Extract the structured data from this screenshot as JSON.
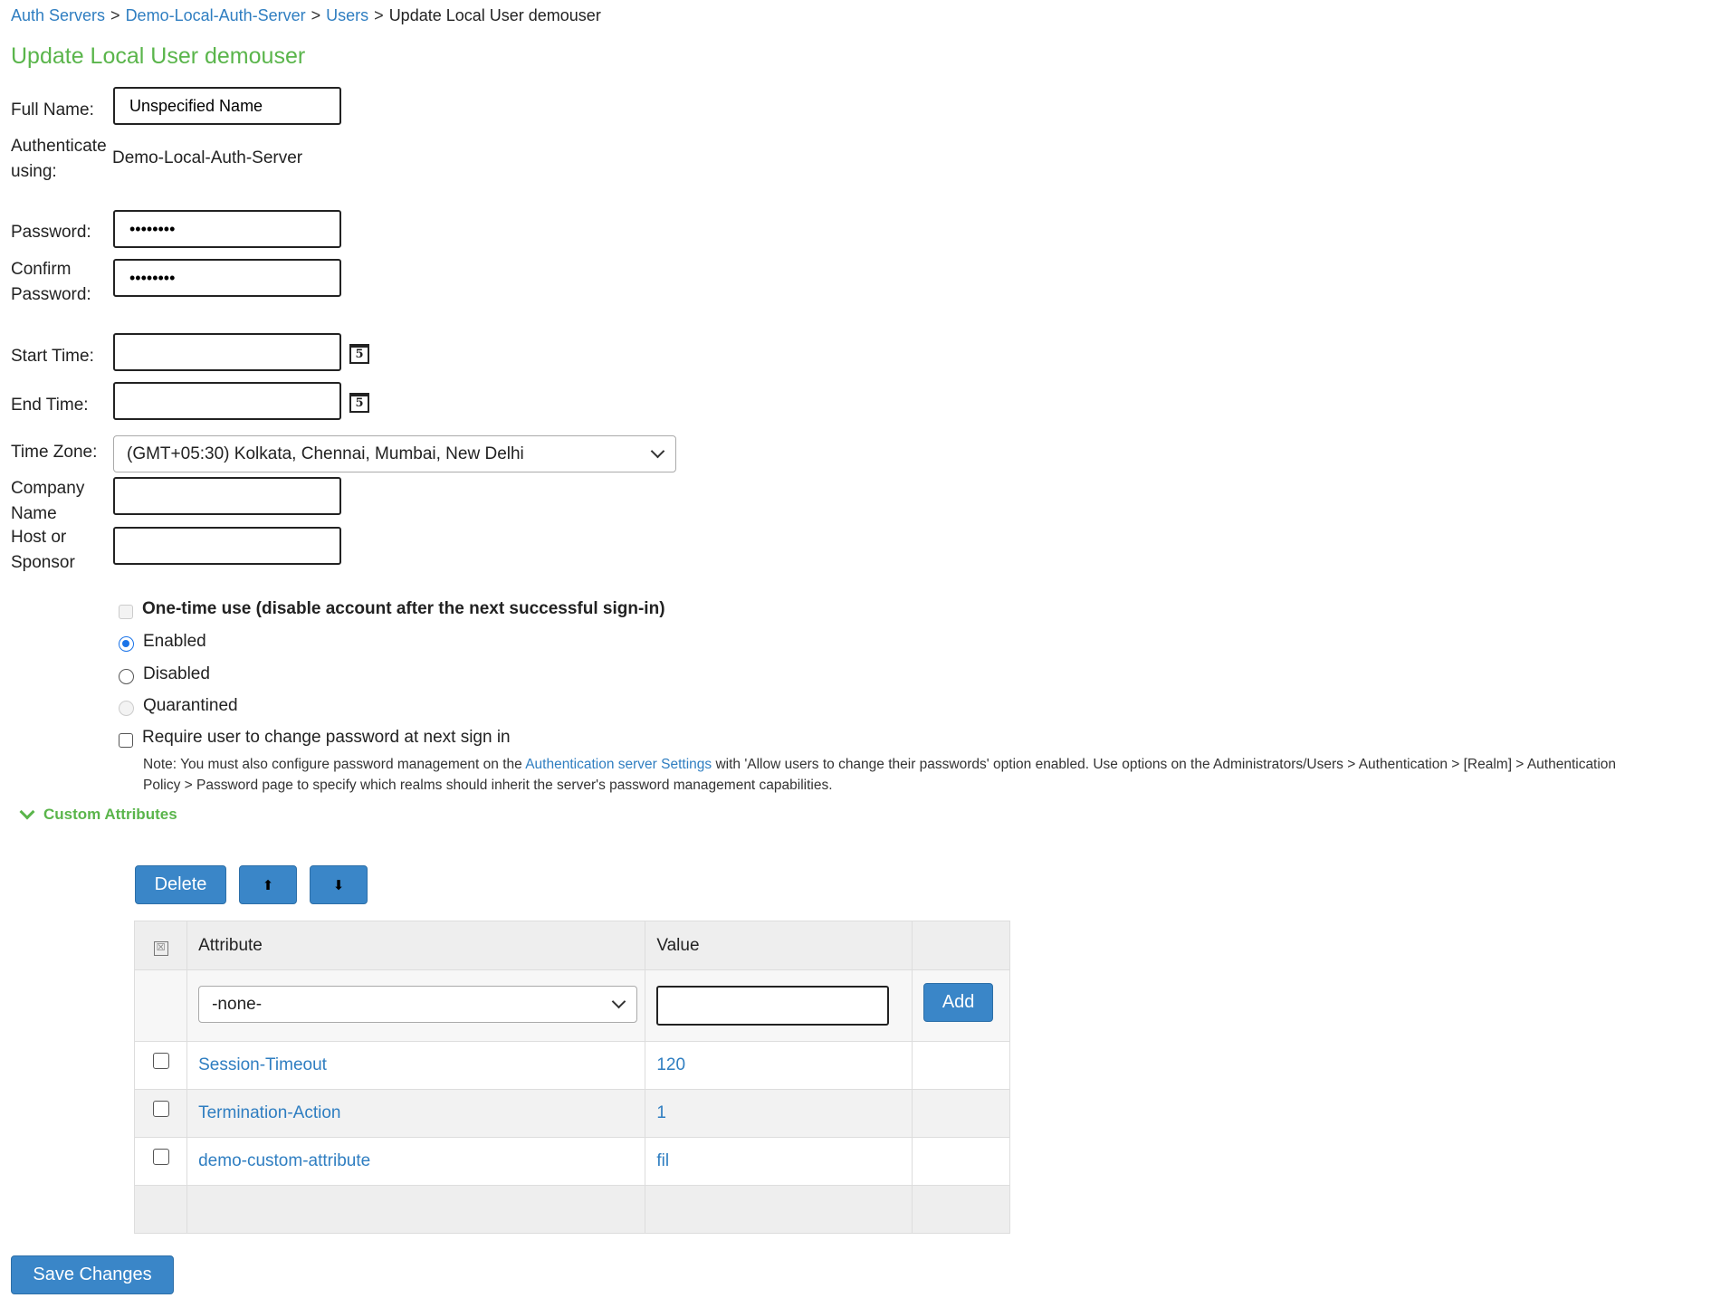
{
  "breadcrumb": {
    "items": [
      "Auth Servers",
      "Demo-Local-Auth-Server",
      "Users"
    ],
    "current": "Update Local User demouser",
    "separator": ">"
  },
  "page_title": "Update Local User demouser",
  "form": {
    "full_name": {
      "label": "Full Name:",
      "value": "Unspecified Name"
    },
    "authenticate": {
      "label_line1": "Authenticate",
      "label_line2": "using:",
      "value": "Demo-Local-Auth-Server"
    },
    "password": {
      "label": "Password:",
      "value": "••••••••"
    },
    "confirm_password": {
      "label_line1": "Confirm",
      "label_line2": "Password:",
      "value": "••••••••"
    },
    "start_time": {
      "label": "Start Time:",
      "value": ""
    },
    "end_time": {
      "label": "End Time:",
      "value": ""
    },
    "calendar_icon_text": "5",
    "time_zone": {
      "label": "Time Zone:",
      "value": "(GMT+05:30) Kolkata, Chennai, Mumbai, New Delhi"
    },
    "company_name": {
      "label_line1": "Company",
      "label_line2": "Name",
      "value": ""
    },
    "host_sponsor": {
      "label_line1": "Host or",
      "label_line2": "Sponsor",
      "value": ""
    }
  },
  "options": {
    "one_time_use": {
      "label": "One-time use (disable account after the next successful sign-in)",
      "checked": false,
      "disabled": true
    },
    "status_selected": "Enabled",
    "enabled": "Enabled",
    "disabled": "Disabled",
    "quarantined": "Quarantined",
    "require_change": {
      "label": "Require user to change password at next sign in",
      "checked": false
    }
  },
  "note": {
    "prefix": "Note: You must also configure password management on the ",
    "link": "Authentication server Settings",
    "suffix": " with 'Allow users to change their passwords' option enabled. Use options on the Administrators/Users > Authentication > [Realm] > Authentication Policy > Password page to specify which realms should inherit the server's password management capabilities."
  },
  "custom_attributes": {
    "section_label": "Custom Attributes",
    "delete_label": "Delete",
    "move_up_symbol": "⬆",
    "move_down_symbol": "⬇",
    "columns": [
      "Attribute",
      "Value"
    ],
    "new_row": {
      "attribute_selected": "-none-",
      "value": "",
      "add_label": "Add"
    },
    "rows": [
      {
        "attribute": "Session-Timeout",
        "value": "120"
      },
      {
        "attribute": "Termination-Action",
        "value": "1"
      },
      {
        "attribute": "demo-custom-attribute",
        "value": "fil"
      }
    ]
  },
  "save_label": "Save Changes",
  "colors": {
    "accent_green": "#5ab54b",
    "link_blue": "#2f7ec1",
    "button_blue": "#3a86c8"
  }
}
